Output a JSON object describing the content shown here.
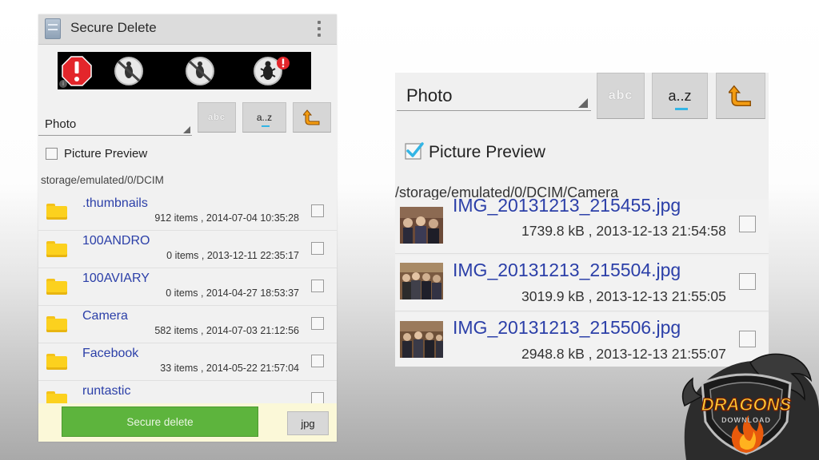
{
  "left_phone": {
    "title": "Secure Delete",
    "sort": {
      "dropdown_value": "Photo",
      "abc_label": "abc",
      "az_label": "a..z"
    },
    "picture_preview_label": "Picture Preview",
    "picture_preview_checked": false,
    "path": "storage/emulated/0/DCIM",
    "folders": [
      {
        "name": ".thumbnails",
        "meta": "912 items , 2014-07-04 10:35:28"
      },
      {
        "name": "100ANDRO",
        "meta": "0 items , 2013-12-11 22:35:17"
      },
      {
        "name": "100AVIARY",
        "meta": "0 items , 2014-04-27 18:53:37"
      },
      {
        "name": "Camera",
        "meta": "582 items , 2014-07-03 21:12:56"
      },
      {
        "name": "Facebook",
        "meta": "33 items , 2014-05-22 21:57:04"
      },
      {
        "name": "runtastic",
        "meta": ""
      }
    ],
    "secure_delete_label": "Secure delete",
    "filter_label": "jpg",
    "ad_icons": [
      "warning-stop-icon",
      "no-bug-icon",
      "no-bug-icon",
      "bug-alert-icon"
    ]
  },
  "right_zoom": {
    "sort": {
      "dropdown_value": "Photo",
      "abc_label": "abc",
      "az_label": "a..z"
    },
    "picture_preview_label": "Picture Preview",
    "picture_preview_checked": true,
    "path": "/storage/emulated/0/DCIM/Camera",
    "files": [
      {
        "name": "IMG_20131213_215455.jpg",
        "meta": "1739.8 kB , 2013-12-13 21:54:58"
      },
      {
        "name": "IMG_20131213_215504.jpg",
        "meta": "3019.9 kB , 2013-12-13 21:55:05"
      },
      {
        "name": "IMG_20131213_215506.jpg",
        "meta": "2948.8 kB , 2013-12-13 21:55:07"
      }
    ]
  },
  "watermark": {
    "line1": "DRAGONS",
    "line2": "DOWNLOAD"
  },
  "colors": {
    "link_blue": "#2b3fa8",
    "accent_green": "#5db43d",
    "holo_blue": "#33b5e5",
    "folder_yellow": "#fcd11e"
  }
}
